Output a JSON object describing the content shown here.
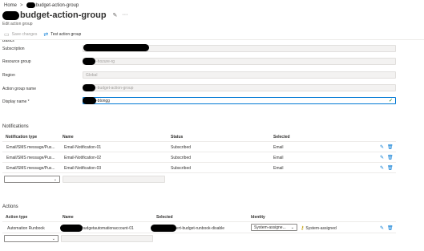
{
  "breadcrumb": {
    "home": "Home",
    "separator": ">",
    "current": "budget-action-group"
  },
  "header": {
    "title": "budget-action-group",
    "subtitle": "Edit action group",
    "pin_icon": "pin-icon",
    "more_icon": "more-icon"
  },
  "toolbar": {
    "save_label": "Save changes",
    "test_label": "Test action group"
  },
  "basics_heading_cut": "Basics",
  "form": {
    "subscription_label": "Subscription",
    "subscription_value": "",
    "resource_group_label": "Resource group",
    "resource_group_value": "-hozure-rg",
    "region_label": "Region",
    "region_value": "Global",
    "action_group_name_label": "Action group name",
    "action_group_name_value": "-budget-action-group",
    "display_name_label": "Display name *",
    "display_name_value": "-btongg"
  },
  "notifications": {
    "heading": "Notifications",
    "columns": [
      "Notification type",
      "Name",
      "Status",
      "Selected"
    ],
    "rows": [
      {
        "type": "Email/SMS message/Pus...",
        "name": "Email-Notification-01",
        "status": "Subscribed",
        "selected": "Email"
      },
      {
        "type": "Email/SMS message/Pus...",
        "name": "Email-Notification-02",
        "status": "Subscribed",
        "selected": "Email"
      },
      {
        "type": "Email/SMS message/Pus...",
        "name": "Email-Notification-03",
        "status": "Subscribed",
        "selected": "Email"
      }
    ]
  },
  "actions": {
    "heading": "Actions",
    "columns": [
      "Action type",
      "Name",
      "Selected",
      "Identity"
    ],
    "rows": [
      {
        "type": "Automation Runbook",
        "name": "budgetautomationaccount-01",
        "selected": "ert-budget-runbook-disable",
        "identity_dropdown": "System-assigne...",
        "identity_value": "System-assigned"
      }
    ]
  }
}
